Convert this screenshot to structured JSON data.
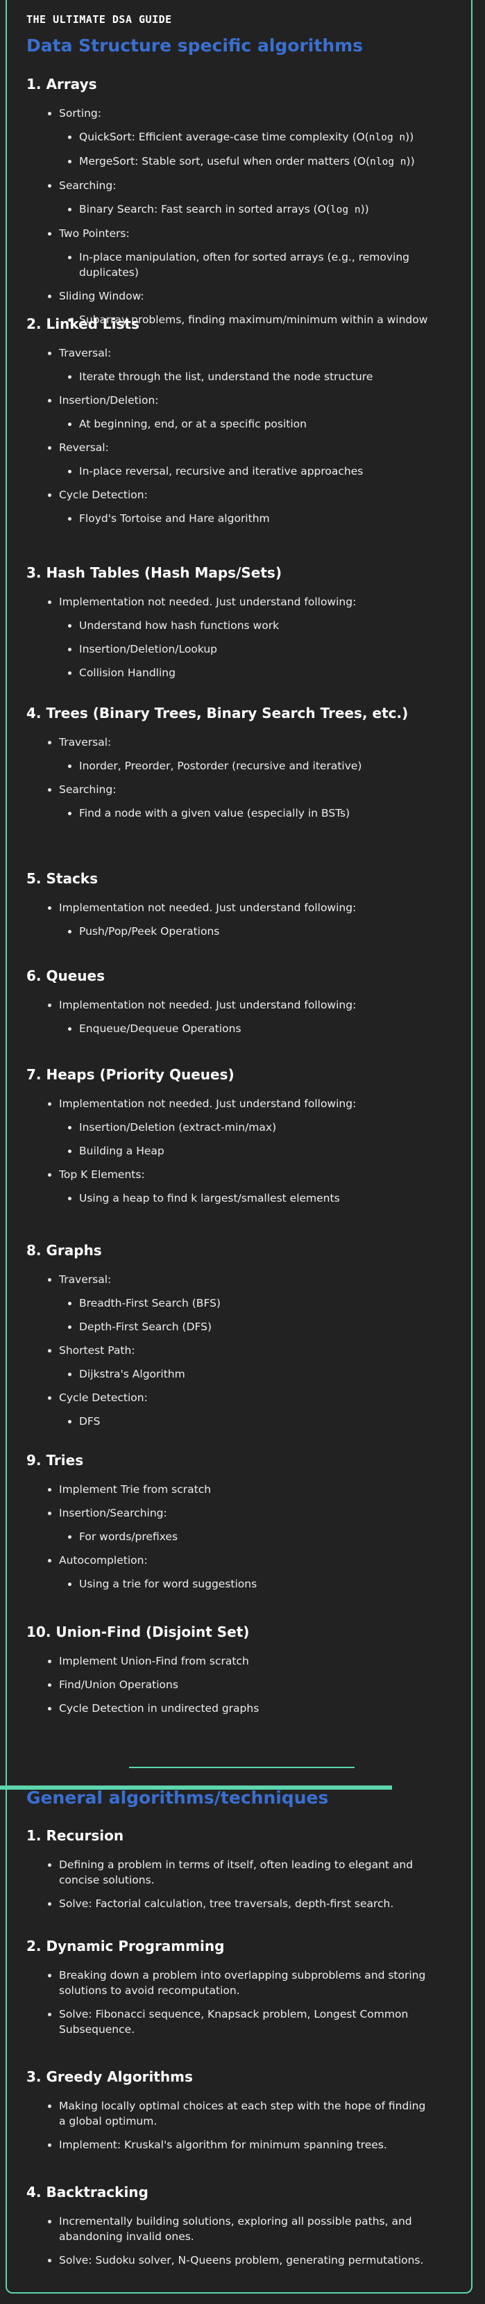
{
  "guide_title": "THE ULTIMATE DSA GUIDE",
  "section1_title": "Data Structure specific algorithms",
  "section2_title": "General algorithms/techniques",
  "colors": {
    "accent": "#3a6fd1",
    "border": "#5bd6ad",
    "background": "#222222"
  },
  "ds": [
    {
      "heading": "1. Arrays",
      "items": [
        {
          "label": "Sorting:",
          "sub": [
            "QuickSort: Efficient average-case time complexity (O(nlog n))",
            "MergeSort: Stable sort, useful when order matters (O(nlog n))"
          ]
        },
        {
          "label": "Searching:",
          "sub": [
            "Binary Search: Fast search in sorted arrays (O(log n))"
          ]
        },
        {
          "label": "Two Pointers:",
          "sub": [
            "In-place manipulation, often for sorted arrays (e.g., removing duplicates)"
          ]
        },
        {
          "label": "Sliding Window:",
          "sub": [
            "Subarray problems, finding maximum/minimum within a window"
          ]
        }
      ]
    },
    {
      "heading": "2. Linked Lists",
      "items": [
        {
          "label": "Traversal:",
          "sub": [
            "Iterate through the list, understand the node structure"
          ]
        },
        {
          "label": "Insertion/Deletion:",
          "sub": [
            "At beginning, end, or at a specific position"
          ]
        },
        {
          "label": "Reversal:",
          "sub": [
            "In-place reversal, recursive and iterative approaches"
          ]
        },
        {
          "label": "Cycle Detection:",
          "sub": [
            "Floyd's Tortoise and Hare algorithm"
          ]
        }
      ]
    },
    {
      "heading": "3. Hash Tables (Hash Maps/Sets)",
      "items": [
        {
          "label": "Implementation not needed. Just understand following:",
          "sub": [
            "Understand how hash functions work",
            "Insertion/Deletion/Lookup",
            "Collision Handling"
          ]
        }
      ]
    },
    {
      "heading": "4. Trees (Binary Trees, Binary Search Trees, etc.)",
      "items": [
        {
          "label": "Traversal:",
          "sub": [
            "Inorder, Preorder, Postorder (recursive and iterative)"
          ]
        },
        {
          "label": "Searching:",
          "sub": [
            "Find a node with a given value (especially in BSTs)"
          ]
        }
      ]
    },
    {
      "heading": "5. Stacks",
      "items": [
        {
          "label": "Implementation not needed. Just understand following:",
          "sub": [
            "Push/Pop/Peek Operations"
          ]
        }
      ]
    },
    {
      "heading": "6. Queues",
      "items": [
        {
          "label": "Implementation not needed. Just understand following:",
          "sub": [
            "Enqueue/Dequeue Operations"
          ]
        }
      ]
    },
    {
      "heading": "7. Heaps (Priority Queues)",
      "items": [
        {
          "label": "Implementation not needed. Just understand following:",
          "sub": [
            "Insertion/Deletion (extract-min/max)",
            "Building a Heap"
          ]
        },
        {
          "label": "Top K Elements:",
          "sub": [
            "Using a heap to find k largest/smallest elements"
          ]
        }
      ]
    },
    {
      "heading": "8. Graphs",
      "items": [
        {
          "label": "Traversal:",
          "sub": [
            "Breadth-First Search (BFS)",
            "Depth-First Search (DFS)"
          ]
        },
        {
          "label": "Shortest Path:",
          "sub": [
            "Dijkstra's Algorithm"
          ]
        },
        {
          "label": "Cycle Detection:",
          "sub": [
            "DFS"
          ]
        }
      ]
    },
    {
      "heading": "9. Tries",
      "items": [
        {
          "label": "Implement Trie from scratch",
          "sub": []
        },
        {
          "label": "Insertion/Searching:",
          "sub": [
            "For words/prefixes"
          ]
        },
        {
          "label": "Autocompletion:",
          "sub": [
            "Using a trie for word suggestions"
          ]
        }
      ]
    },
    {
      "heading": "10. Union-Find (Disjoint Set)",
      "items": [
        {
          "label": "Implement Union-Find from scratch",
          "sub": []
        },
        {
          "label": "Find/Union Operations",
          "sub": []
        },
        {
          "label": "Cycle Detection in undirected graphs",
          "sub": []
        }
      ]
    }
  ],
  "general": [
    {
      "heading": "1. Recursion",
      "items": [
        "Defining a problem in terms of itself, often leading to elegant and concise solutions.",
        "Solve: Factorial calculation, tree traversals, depth-first search."
      ]
    },
    {
      "heading": "2. Dynamic Programming",
      "items": [
        "Breaking down a problem into overlapping subproblems and storing solutions to avoid recomputation.",
        "Solve: Fibonacci sequence, Knapsack problem, Longest Common Subsequence."
      ]
    },
    {
      "heading": "3. Greedy Algorithms",
      "items": [
        "Making locally optimal choices at each step with the hope of finding a global optimum.",
        "Implement: Kruskal's algorithm for minimum spanning trees."
      ]
    },
    {
      "heading": "4. Backtracking",
      "items": [
        "Incrementally building solutions, exploring all possible paths, and abandoning invalid ones.",
        "Solve: Sudoku solver, N-Queens problem, generating permutations."
      ]
    }
  ]
}
